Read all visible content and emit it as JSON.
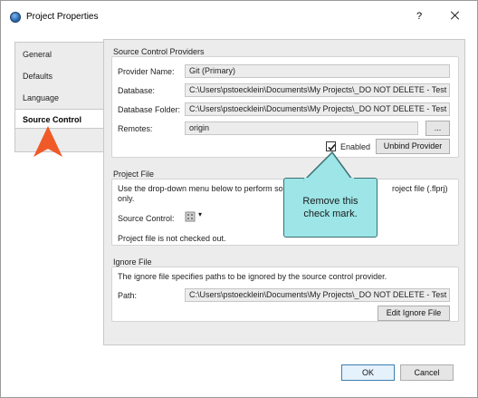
{
  "window": {
    "title": "Project Properties",
    "help": "?"
  },
  "tabs": [
    {
      "label": "General"
    },
    {
      "label": "Defaults"
    },
    {
      "label": "Language"
    },
    {
      "label": "Source Control"
    }
  ],
  "providers": {
    "title": "Source Control Providers",
    "provider_name_label": "Provider Name:",
    "provider_name_value": "Git (Primary)",
    "database_label": "Database:",
    "database_value": "C:\\Users\\pstoecklein\\Documents\\My Projects\\_DO NOT DELETE - Test Branc",
    "database_folder_label": "Database Folder:",
    "database_folder_value": "C:\\Users\\pstoecklein\\Documents\\My Projects\\_DO NOT DELETE - Test Branc",
    "remotes_label": "Remotes:",
    "remotes_value": "origin",
    "browse_label": "...",
    "enabled_label": "Enabled",
    "enabled_checked": true,
    "unbind_label": "Unbind Provider"
  },
  "project_file": {
    "title": "Project File",
    "description_line1": "Use the drop-down menu below to perform sour",
    "description_tail": "roject file (.flprj)",
    "description_line2": "only.",
    "source_control_label": "Source Control:",
    "dropdown_caret": "▾",
    "status": "Project file is not checked out."
  },
  "ignore_file": {
    "title": "Ignore File",
    "description": "The ignore file specifies paths to be ignored by the source control provider.",
    "path_label": "Path:",
    "path_value": "C:\\Users\\pstoecklein\\Documents\\My Projects\\_DO NOT DELETE - Test Branc",
    "edit_label": "Edit Ignore File"
  },
  "callout": {
    "line1": "Remove this",
    "line2": "check mark."
  },
  "footer": {
    "ok_label": "OK",
    "cancel_label": "Cancel"
  },
  "colors": {
    "callout_fill": "#9de5e7",
    "marker_orange": "#f05a28"
  }
}
